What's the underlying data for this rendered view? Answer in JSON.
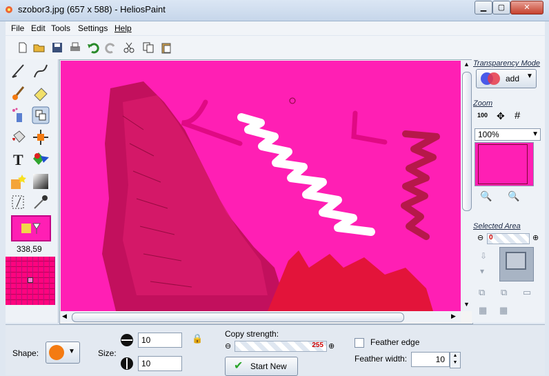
{
  "window": {
    "title": "szobor3.jpg (657 x 588) - HeliosPaint",
    "minimize_icon": "minimize-icon",
    "maximize_icon": "maximize-icon",
    "close_icon": "close-icon"
  },
  "menu": {
    "items": [
      "File",
      "Edit",
      "Tools",
      "Settings",
      "Help"
    ]
  },
  "toolbar": {
    "icons": [
      "new-file-icon",
      "open-folder-icon",
      "save-icon",
      "print-icon",
      "undo-icon",
      "redo-icon",
      "cut-icon",
      "copy-icon",
      "paste-icon"
    ]
  },
  "tools": {
    "icons": [
      "pencil-icon",
      "curve-icon",
      "brush-icon",
      "eraser-icon",
      "spray-icon",
      "clone-stamp-icon",
      "paint-bucket-icon",
      "move-icon",
      "text-icon",
      "shapes-icon",
      "magic-wand-icon",
      "gradient-icon",
      "transform-icon",
      "color-picker-icon"
    ],
    "coords": "338,59"
  },
  "colors": {
    "image_bg": "#ff1fb4",
    "accent_orange": "#f47b12",
    "selected_area_bg": "#a8b4c4"
  },
  "right_panel": {
    "transparency_label": "Transparency Mode",
    "transparency_value": "add",
    "zoom_label": "Zoom",
    "zoom_value": "100%",
    "selected_area_label": "Selected Area",
    "selected_area_value": "0"
  },
  "bottom": {
    "shape_label": "Shape:",
    "size_label": "Size:",
    "size_width": "10",
    "size_height": "10",
    "copy_strength_label": "Copy strength:",
    "copy_strength_value": "255",
    "start_new_label": "Start New",
    "feather_edge_label": "Feather edge",
    "feather_width_label": "Feather width:",
    "feather_width_value": "10"
  }
}
